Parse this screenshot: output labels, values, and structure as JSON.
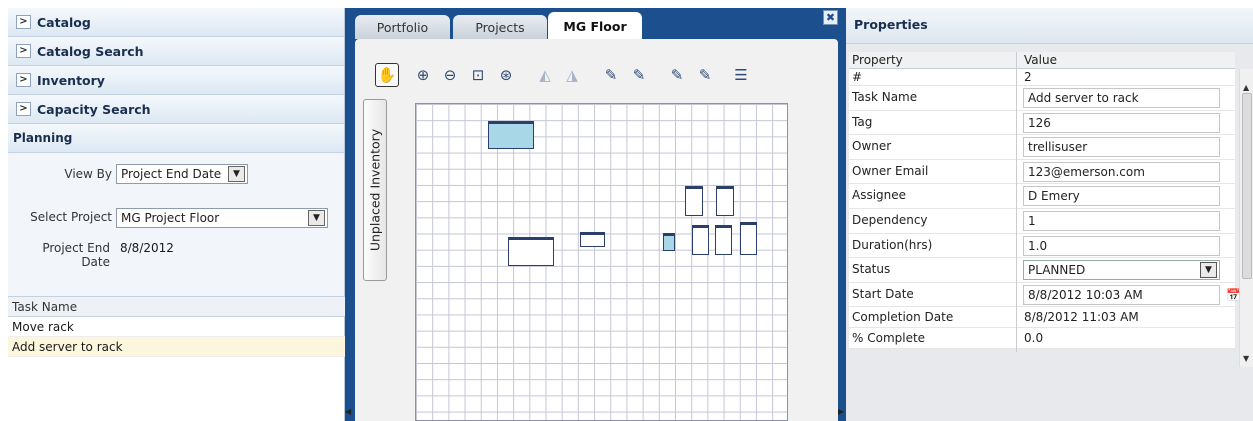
{
  "left": {
    "accordion": [
      {
        "label": "Catalog"
      },
      {
        "label": "Catalog Search"
      },
      {
        "label": "Inventory"
      },
      {
        "label": "Capacity Search"
      }
    ],
    "planning": {
      "title": "Planning",
      "view_by_label": "View By",
      "view_by_value": "Project End Date",
      "select_project_label": "Select Project",
      "select_project_value": "MG Project Floor",
      "end_date_label_1": "Project End",
      "end_date_label_2": "Date",
      "end_date_value": "8/8/2012"
    },
    "tasks": {
      "header": "Task Name",
      "rows": [
        "Move rack",
        "Add server to rack"
      ]
    }
  },
  "center": {
    "tabs": [
      "Portfolio",
      "Projects",
      "MG Floor"
    ],
    "close_glyph": "✖",
    "side_tab_label": "Unplaced Inventory",
    "toolbar_icons": [
      "hand-tool-icon",
      "zoom-in-icon",
      "zoom-out-icon",
      "zoom-fit-icon",
      "zoom-region-icon",
      "flip-horizontal-icon",
      "flip-vertical-icon",
      "edit-note-1-icon",
      "edit-note-2-icon",
      "edit-note-3-icon",
      "edit-note-4-icon",
      "legend-icon"
    ]
  },
  "right": {
    "title": "Properties",
    "col_property": "Property",
    "col_value": "Value",
    "rows": [
      {
        "name": "#",
        "value": "2",
        "input": false
      },
      {
        "name": "Task Name",
        "value": "Add server to rack",
        "input": true
      },
      {
        "name": "Tag",
        "value": "126",
        "input": true
      },
      {
        "name": "Owner",
        "value": "trellisuser",
        "input": true
      },
      {
        "name": "Owner Email",
        "value": "123@emerson.com",
        "input": true
      },
      {
        "name": "Assignee",
        "value": "D Emery",
        "input": true
      },
      {
        "name": "Dependency",
        "value": "1",
        "input": true
      },
      {
        "name": "Duration(hrs)",
        "value": "1.0",
        "input": true
      },
      {
        "name": "Status",
        "value": "PLANNED",
        "input": true,
        "dropdown": true
      },
      {
        "name": "Start Date",
        "value": "8/8/2012 10:03 AM",
        "input": true,
        "calendar": true
      },
      {
        "name": "Completion Date",
        "value": "8/8/2012 11:03 AM",
        "input": false
      },
      {
        "name": "% Complete",
        "value": "0.0",
        "input": false
      }
    ]
  },
  "colors": {
    "frame_blue": "#1b4f8e",
    "selected_rack": "#a8d8e8",
    "selected_row": "#fcf6dd"
  }
}
